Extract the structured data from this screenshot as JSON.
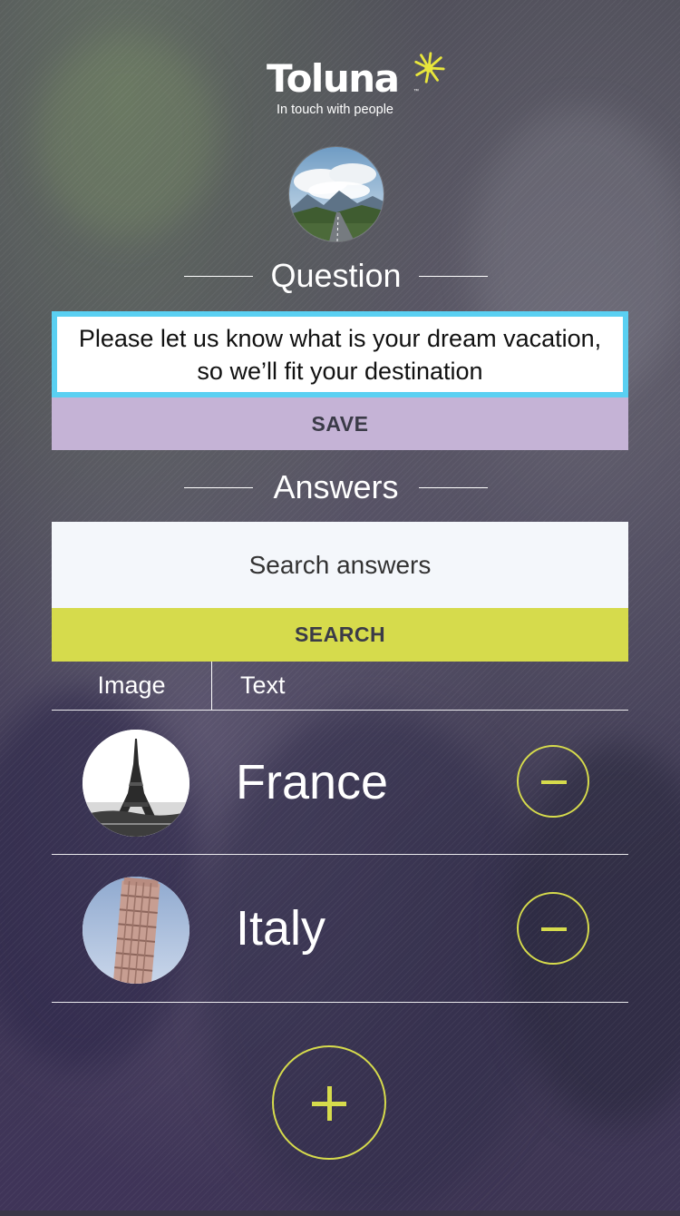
{
  "brand": {
    "name": "Toluna",
    "trademark": "™",
    "tagline": "In touch with people",
    "accent_color": "#d6db4c",
    "star_color": "#e8e63c"
  },
  "question_section": {
    "heading": "Question",
    "avatar_icon": "mountain-road-photo",
    "text": "Please let us know what is your dream vacation, so we’ll fit your destination",
    "save_label": "SAVE",
    "focus_border_color": "#5ad0f2",
    "save_color": "#c5b3d6"
  },
  "answers_section": {
    "heading": "Answers",
    "search_placeholder": "Search answers",
    "search_label": "SEARCH",
    "tabs": [
      {
        "label": "Image"
      },
      {
        "label": "Text"
      }
    ],
    "items": [
      {
        "label": "France",
        "icon": "eiffel-tower-photo",
        "action_icon": "minus-icon"
      },
      {
        "label": "Italy",
        "icon": "leaning-tower-of-pisa-photo",
        "action_icon": "minus-icon"
      }
    ],
    "add_icon": "plus-icon"
  }
}
